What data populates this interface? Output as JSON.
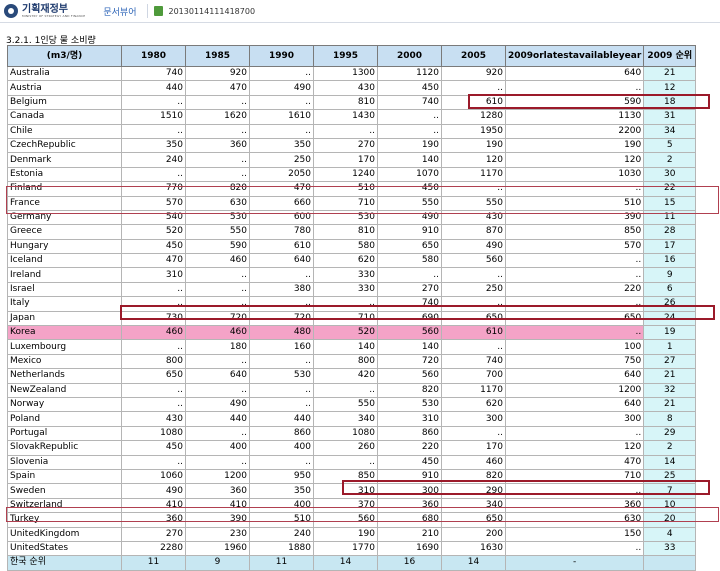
{
  "topbar": {
    "logo_name": "기획재정부",
    "logo_sub": "MINISTRY OF STRATEGY AND FINANCE",
    "doc_view": "문서뷰어",
    "doc_id": "20130114111418700"
  },
  "sheet_title": "3.2.1. 1인당 물 소비량",
  "headers": [
    "(m3/명)",
    "1980",
    "1985",
    "1990",
    "1995",
    "2000",
    "2005",
    "2009orlatestavailableyear",
    "2009 순위"
  ],
  "rows": [
    {
      "country": "Australia",
      "v": [
        "740",
        "920",
        "..",
        "1300",
        "1120",
        "920",
        "640"
      ],
      "rank": "21"
    },
    {
      "country": "Austria",
      "v": [
        "440",
        "470",
        "490",
        "430",
        "450",
        "..",
        ".."
      ],
      "rank": "12"
    },
    {
      "country": "Belgium",
      "v": [
        "..",
        "..",
        "..",
        "810",
        "740",
        "610",
        "590"
      ],
      "rank": "18"
    },
    {
      "country": "Canada",
      "v": [
        "1510",
        "1620",
        "1610",
        "1430",
        "..",
        "1280",
        "1130"
      ],
      "rank": "31"
    },
    {
      "country": "Chile",
      "v": [
        "..",
        "..",
        "..",
        "..",
        "..",
        "1950",
        "2200"
      ],
      "rank": "34"
    },
    {
      "country": "CzechRepublic",
      "v": [
        "350",
        "360",
        "350",
        "270",
        "190",
        "190",
        "190"
      ],
      "rank": "5"
    },
    {
      "country": "Denmark",
      "v": [
        "240",
        "..",
        "250",
        "170",
        "140",
        "120",
        "120"
      ],
      "rank": "2"
    },
    {
      "country": "Estonia",
      "v": [
        "..",
        "..",
        "2050",
        "1240",
        "1070",
        "1170",
        "1030"
      ],
      "rank": "30"
    },
    {
      "country": "Finland",
      "v": [
        "770",
        "820",
        "470",
        "510",
        "450",
        "..",
        ".."
      ],
      "rank": "22"
    },
    {
      "country": "France",
      "v": [
        "570",
        "630",
        "660",
        "710",
        "550",
        "550",
        "510"
      ],
      "rank": "15"
    },
    {
      "country": "Germany",
      "v": [
        "540",
        "530",
        "600",
        "530",
        "490",
        "430",
        "390"
      ],
      "rank": "11"
    },
    {
      "country": "Greece",
      "v": [
        "520",
        "550",
        "780",
        "810",
        "910",
        "870",
        "850"
      ],
      "rank": "28"
    },
    {
      "country": "Hungary",
      "v": [
        "450",
        "590",
        "610",
        "580",
        "650",
        "490",
        "570"
      ],
      "rank": "17"
    },
    {
      "country": "Iceland",
      "v": [
        "470",
        "460",
        "640",
        "620",
        "580",
        "560",
        ".."
      ],
      "rank": "16"
    },
    {
      "country": "Ireland",
      "v": [
        "310",
        "..",
        "..",
        "330",
        "..",
        "..",
        ".."
      ],
      "rank": "9"
    },
    {
      "country": "Israel",
      "v": [
        "..",
        "..",
        "380",
        "330",
        "270",
        "250",
        "220"
      ],
      "rank": "6"
    },
    {
      "country": "Italy",
      "v": [
        "..",
        "..",
        "..",
        "..",
        "740",
        "..",
        ".."
      ],
      "rank": "26"
    },
    {
      "country": "Japan",
      "v": [
        "730",
        "720",
        "720",
        "710",
        "690",
        "650",
        "650"
      ],
      "rank": "24"
    },
    {
      "country": "Korea",
      "v": [
        "460",
        "460",
        "480",
        "520",
        "560",
        "610",
        ".."
      ],
      "rank": "19"
    },
    {
      "country": "Luxembourg",
      "v": [
        "..",
        "180",
        "160",
        "140",
        "140",
        "..",
        "100"
      ],
      "rank": "1"
    },
    {
      "country": "Mexico",
      "v": [
        "800",
        "..",
        "..",
        "800",
        "720",
        "740",
        "750"
      ],
      "rank": "27"
    },
    {
      "country": "Netherlands",
      "v": [
        "650",
        "640",
        "530",
        "420",
        "560",
        "700",
        "640"
      ],
      "rank": "21"
    },
    {
      "country": "NewZealand",
      "v": [
        "..",
        "..",
        "..",
        "..",
        "820",
        "1170",
        "1200"
      ],
      "rank": "32"
    },
    {
      "country": "Norway",
      "v": [
        "..",
        "490",
        "..",
        "550",
        "530",
        "620",
        "640"
      ],
      "rank": "21"
    },
    {
      "country": "Poland",
      "v": [
        "430",
        "440",
        "440",
        "340",
        "310",
        "300",
        "300"
      ],
      "rank": "8"
    },
    {
      "country": "Portugal",
      "v": [
        "1080",
        "..",
        "860",
        "1080",
        "860",
        "..",
        ".."
      ],
      "rank": "29"
    },
    {
      "country": "SlovakRepublic",
      "v": [
        "450",
        "400",
        "400",
        "260",
        "220",
        "170",
        "120"
      ],
      "rank": "2"
    },
    {
      "country": "Slovenia",
      "v": [
        "..",
        "..",
        "..",
        "..",
        "450",
        "460",
        "470"
      ],
      "rank": "14"
    },
    {
      "country": "Spain",
      "v": [
        "1060",
        "1200",
        "950",
        "850",
        "910",
        "820",
        "710"
      ],
      "rank": "25"
    },
    {
      "country": "Sweden",
      "v": [
        "490",
        "360",
        "350",
        "310",
        "300",
        "290",
        ".."
      ],
      "rank": "7"
    },
    {
      "country": "Switzerland",
      "v": [
        "410",
        "410",
        "400",
        "370",
        "360",
        "340",
        "360"
      ],
      "rank": "10"
    },
    {
      "country": "Turkey",
      "v": [
        "360",
        "390",
        "510",
        "560",
        "680",
        "650",
        "630"
      ],
      "rank": "20"
    },
    {
      "country": "UnitedKingdom",
      "v": [
        "270",
        "230",
        "240",
        "190",
        "210",
        "200",
        "150"
      ],
      "rank": "4"
    },
    {
      "country": "UnitedStates",
      "v": [
        "2280",
        "1960",
        "1880",
        "1770",
        "1690",
        "1630",
        ".."
      ],
      "rank": "33"
    }
  ],
  "footer": {
    "label": "한국 순위",
    "v": [
      "11",
      "9",
      "11",
      "14",
      "16",
      "14",
      "-"
    ],
    "rank": ""
  },
  "colors": {
    "header_bg": "#c8dff2",
    "korea_row": "#f4a3c7",
    "rank_col": "#d7f5f8",
    "highlight_box": "#9b1a2a"
  }
}
